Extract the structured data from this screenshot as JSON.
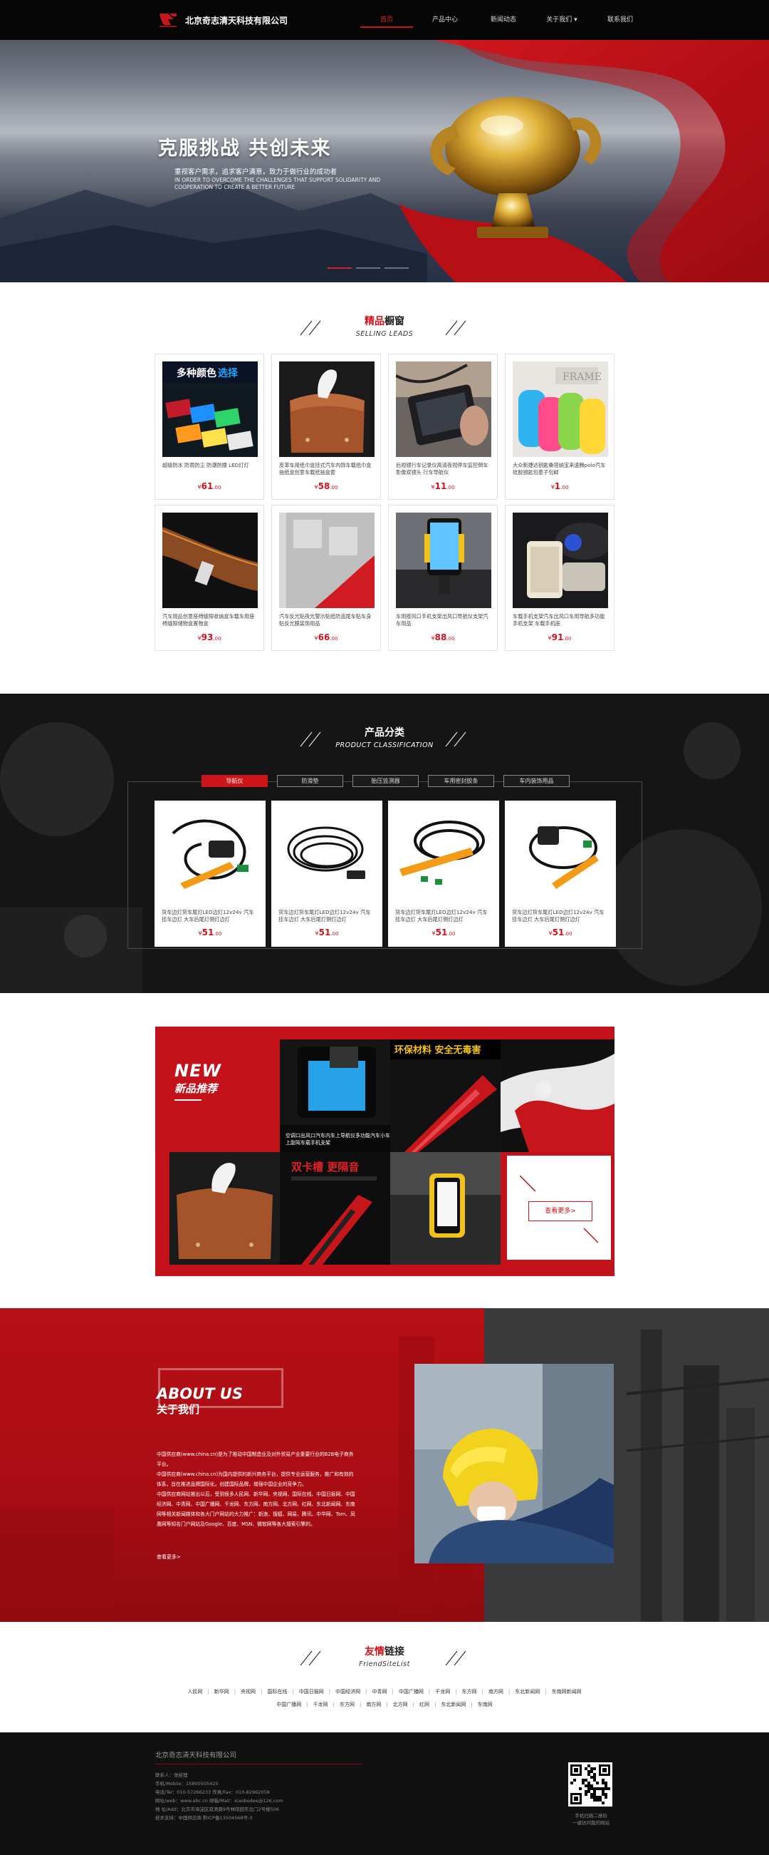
{
  "header": {
    "company": "北京奇志清天科技有限公司",
    "nav": [
      {
        "label": "首页",
        "active": true
      },
      {
        "label": "产品中心",
        "active": false
      },
      {
        "label": "新闻动态",
        "active": false
      },
      {
        "label": "关于我们 ▾",
        "active": false
      },
      {
        "label": "联系我们",
        "active": false
      }
    ]
  },
  "hero": {
    "title": "克服挑战 共创未来",
    "subtitle": "重视客户需求，追求客户满意，致力于做行业的成功者",
    "subtitle_en": "IN ORDER TO OVERCOME THE CHALLENGES THAT SUPPORT SOLIDARITY AND COOPERATION TO CREATE A BETTER FUTURE"
  },
  "selling": {
    "title_red": "精品",
    "title_rest": "橱窗",
    "subtitle": "SELLING LEADS",
    "products": [
      {
        "desc": "超级防水 防雨防尘 防潮防撞 LED灯灯",
        "price": "61",
        "cents": ".00"
      },
      {
        "desc": "皮革车用纸巾盒挂式汽车内饰车载纸巾盒抽纸盒创意车载纸抽盒套",
        "price": "58",
        "cents": ".00"
      },
      {
        "desc": "后视镜行车记录仪高清夜视停车监控倒车影像双镜头 行车导航仪",
        "price": "11",
        "cents": ".00"
      },
      {
        "desc": "大众新捷达钥匙桑塔纳宝来速腾polo汽车硅胶钥匙包套子包邮",
        "price": "1",
        "cents": ".00"
      },
      {
        "desc": "汽车用品创意座椅缝隙收纳盒车载车用座椅缝隙储物盒置物盒",
        "price": "93",
        "cents": ".00"
      },
      {
        "desc": "汽车反光贴夜光警示贴纸防追尾车贴车身贴反光膜装饰用品",
        "price": "66",
        "cents": ".00"
      },
      {
        "desc": "车用按风口手机支架出风口导航仪支架汽车用品",
        "price": "88",
        "cents": ".00"
      },
      {
        "desc": "车载手机支架汽车出风口车用导航多功能手机支架 车载手机座",
        "price": "91",
        "cents": ".00"
      }
    ]
  },
  "classification": {
    "title": "产品分类",
    "subtitle": "PRODUCT CLASSIFICATION",
    "tabs": [
      {
        "label": "导航仪",
        "active": true
      },
      {
        "label": "防滑垫",
        "active": false
      },
      {
        "label": "胎压监测器",
        "active": false
      },
      {
        "label": "车用密封胶条",
        "active": false
      },
      {
        "label": "车内装饰用品",
        "active": false
      }
    ],
    "products": [
      {
        "desc": "货车边灯货车尾灯LED边灯12v24v 汽车挂车边灯 大车后尾灯侧灯边灯",
        "price": "51",
        "cents": ".00"
      },
      {
        "desc": "货车边灯货车尾灯LED边灯12v24v 汽车挂车边灯 大车后尾灯侧灯边灯",
        "price": "51",
        "cents": ".00"
      },
      {
        "desc": "货车边灯货车尾灯LED边灯12v24v 汽车挂车边灯 大车后尾灯侧灯边灯",
        "price": "51",
        "cents": ".00"
      },
      {
        "desc": "货车边灯货车尾灯LED边灯12v24v 汽车挂车边灯 大车后尾灯侧灯边灯",
        "price": "51",
        "cents": ".00"
      }
    ]
  },
  "newproducts": {
    "label_en": "NEW",
    "label_cn": "新品推荐",
    "tile_caption": "空调口出风口汽车内车上导航仪多功能汽车小车上副驾车载手机支架",
    "banner1_text": "环保材料 安全无毒害",
    "banner2_text": "双卡槽 更隔音",
    "more": "查看更多>"
  },
  "about": {
    "title_en": "ABOUT US",
    "title_cn": "关于我们",
    "paragraphs": [
      "中国供应商(www.china.cn)是为了推动中国制造业及对外贸易产业重要行业的B2B电子商务平台。",
      "中国供应商(www.china.cn)为国内提供的新兴商务平台，提供专业运营服务，推广和有效的体系，旨在推进品牌国际化，创建国际品牌，增强中国企业的竞争力。",
      "中国供应商网站推出以后，受到很多人民网、新华网、央视网、国际在线、中国日报网、中国经济网、中青网、中国广播网、千龙网、东方网、南方网、北方网、红网、东北新闻网、东南网等相关新闻媒体和各大门户网站的大力推广：新浪、搜狐、网易、腾讯、中华网、Tom、凤凰网等知名门户网站及Google、百度、MSN、微软网等各大搜索引擎的。"
    ],
    "more": "查看更多>"
  },
  "links": {
    "title_red": "友情",
    "title_rest": "链接",
    "subtitle": "FriendSiteList",
    "row1": [
      "人民网",
      "新华网",
      "央视网",
      "国际在线",
      "中国日报网",
      "中国经济网",
      "中青网",
      "中国广播网",
      "千龙网",
      "东方网",
      "南方网",
      "东北新闻网",
      "东南网新闻网"
    ],
    "row2": [
      "中国广播网",
      "千龙网",
      "东方网",
      "南方网",
      "北方网",
      "红网",
      "东北新闻网",
      "东南网"
    ]
  },
  "footer": {
    "company": "北京奇志清天科技有限公司",
    "info": [
      "联系人：张经理",
      "手机/Mobile：15800505425",
      "电话/Tel：010-57266233        传真/Fax：010-82962058",
      "网址/web：www.abc.cn           邮箱/Mail：xiaobodee@126.com",
      "地 址/Add：北京市海淀区双清路9号林阳园东北门2号楼506",
      "技术支持：中国供应商    黔ICP备13504568号-3"
    ],
    "qr_caption": "手机扫描二维码\n一键访问我的网站"
  },
  "colors": {
    "accent": "#c4121a",
    "dark": "#111111"
  }
}
